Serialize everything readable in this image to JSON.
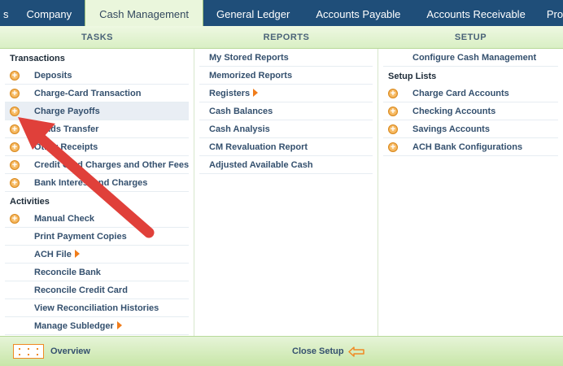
{
  "topnav": {
    "tabs": [
      {
        "label": "s"
      },
      {
        "label": "Company"
      },
      {
        "label": "Cash Management"
      },
      {
        "label": "General Ledger"
      },
      {
        "label": "Accounts Payable"
      },
      {
        "label": "Accounts Receivable"
      },
      {
        "label": "Pro"
      }
    ]
  },
  "headers": {
    "tasks": "TASKS",
    "reports": "REPORTS",
    "setup": "SETUP"
  },
  "tasks": {
    "transactions_label": "Transactions",
    "transactions": [
      {
        "label": "Deposits"
      },
      {
        "label": "Charge-Card Transaction"
      },
      {
        "label": "Charge Payoffs"
      },
      {
        "label": "Funds Transfer"
      },
      {
        "label": "Other Receipts"
      },
      {
        "label": "Credit Card Charges and Other Fees"
      },
      {
        "label": "Bank Interest and Charges"
      }
    ],
    "activities_label": "Activities",
    "activities": [
      {
        "label": "Manual Check"
      },
      {
        "label": "Print Payment Copies"
      },
      {
        "label": "ACH File"
      },
      {
        "label": "Reconcile Bank"
      },
      {
        "label": "Reconcile Credit Card"
      },
      {
        "label": "View Reconciliation Histories"
      },
      {
        "label": "Manage Subledger"
      }
    ]
  },
  "reports": {
    "items": [
      {
        "label": "My Stored Reports"
      },
      {
        "label": "Memorized Reports"
      },
      {
        "label": "Registers"
      },
      {
        "label": "Cash Balances"
      },
      {
        "label": "Cash Analysis"
      },
      {
        "label": "CM Revaluation Report"
      },
      {
        "label": "Adjusted Available Cash"
      }
    ]
  },
  "setup": {
    "configure": "Configure Cash Management",
    "lists_label": "Setup Lists",
    "lists": [
      {
        "label": "Charge Card Accounts"
      },
      {
        "label": "Checking Accounts"
      },
      {
        "label": "Savings Accounts"
      },
      {
        "label": "ACH Bank Configurations"
      }
    ]
  },
  "bottom": {
    "overview": "Overview",
    "close_setup": "Close Setup"
  },
  "colors": {
    "nav": "#1f4e79",
    "accent": "#f08a24",
    "annotation_arrow": "#e0403a"
  }
}
